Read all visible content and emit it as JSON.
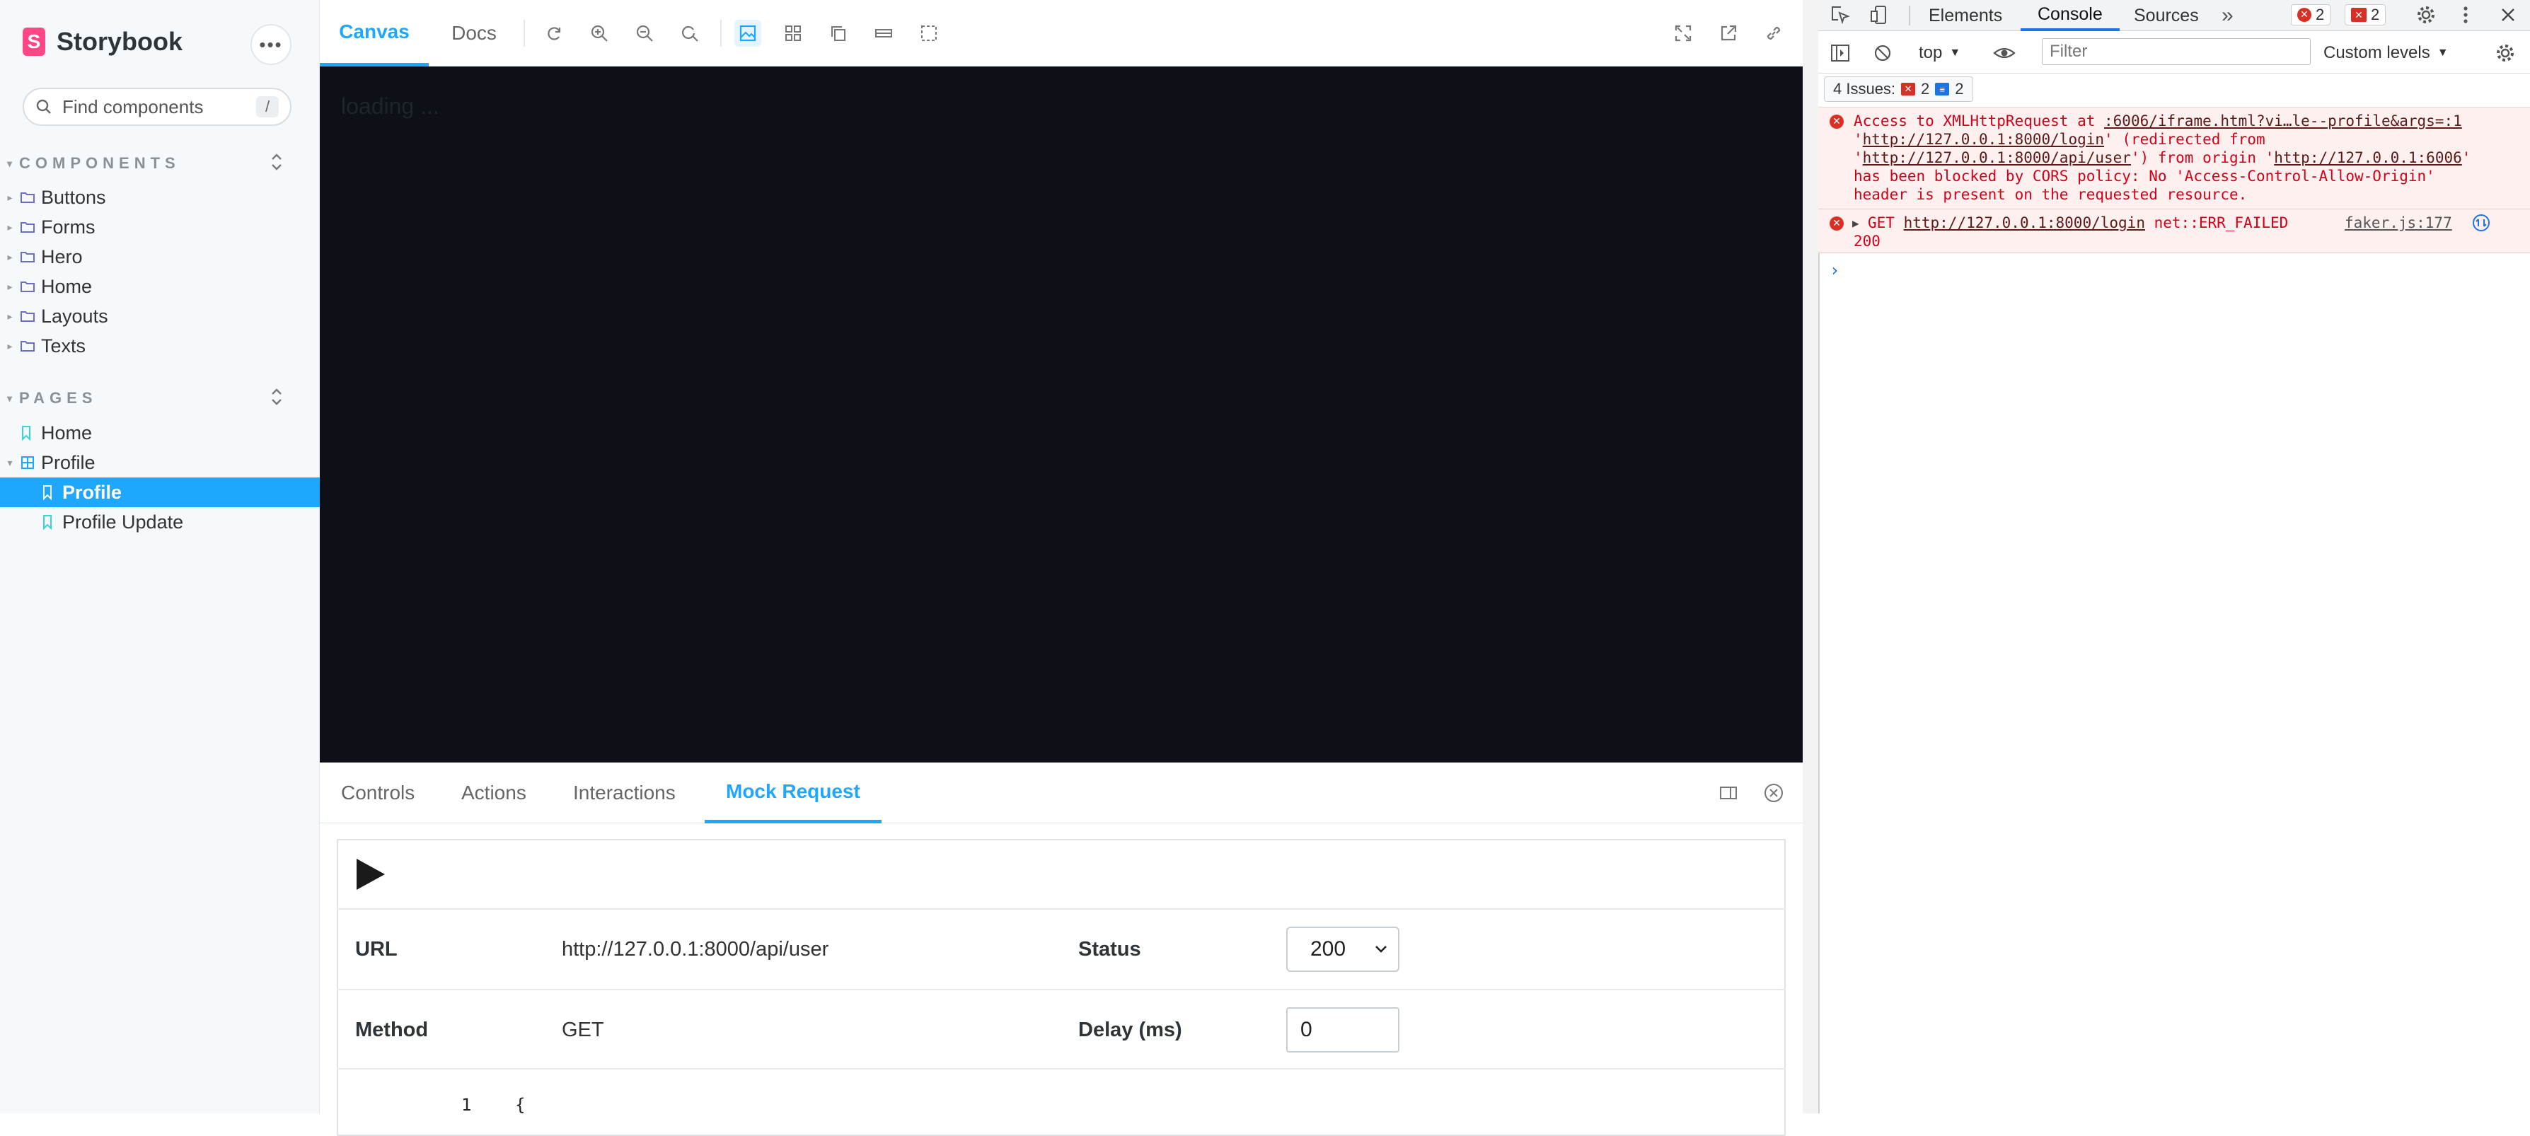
{
  "sidebar": {
    "brand": "Storybook",
    "brand_logo_letter": "S",
    "menu_glyph": "•••",
    "search_placeholder": "Find components",
    "search_shortcut": "/",
    "components_title": "COMPONENTS",
    "components": [
      "Buttons",
      "Forms",
      "Hero",
      "Home",
      "Layouts",
      "Texts"
    ],
    "pages_title": "PAGES",
    "pages": {
      "home": "Home",
      "profile_group": "Profile",
      "profile": "Profile",
      "profile_update": "Profile Update"
    }
  },
  "toolbar": {
    "tabs": [
      "Canvas",
      "Docs"
    ],
    "icons": [
      "reload-icon",
      "zoom-in-icon",
      "zoom-out-icon",
      "zoom-reset-icon",
      "background-icon",
      "grid-icon",
      "viewport-icon",
      "measure-icon",
      "outline-icon",
      "fullscreen-icon",
      "open-new-tab-icon",
      "copy-link-icon"
    ]
  },
  "canvas": {
    "loading_text": "loading ...",
    "background": "#0d1117"
  },
  "addons": {
    "tabs": [
      "Controls",
      "Actions",
      "Interactions",
      "Mock Request"
    ],
    "active_tab": "Mock Request",
    "url_label": "URL",
    "url_value": "http://127.0.0.1:8000/api/user",
    "status_label": "Status",
    "status_value": "200",
    "method_label": "Method",
    "method_value": "GET",
    "delay_label": "Delay (ms)",
    "delay_value": "0",
    "code_line_number": "1",
    "code_line_text": "{"
  },
  "devtools": {
    "tabs": [
      "Elements",
      "Console",
      "Sources"
    ],
    "more_glyph": "»",
    "error_count": "2",
    "warning_count": "2",
    "context": "top",
    "filter_placeholder": "Filter",
    "levels": "Custom levels",
    "issues_label": "4 Issues:",
    "issues_errors": "2",
    "issues_info": "2",
    "messages": {
      "cors": {
        "text_1": "Access to XMLHttpRequest at ",
        "link_1": ":6006/iframe.html?vi…le--profile&args=:1",
        "text_2": "'",
        "link_2": "http://127.0.0.1:8000/login",
        "text_3": "' (redirected from '",
        "link_3": "http://127.0.0.1:8000/api/user",
        "text_4": "') from origin '",
        "link_4": "http://127.0.0.1:6006",
        "text_5": "' has been blocked by CORS policy: No 'Access-Control-Allow-Origin' header is present on the requested resource."
      },
      "get": {
        "method": "GET",
        "url": "http://127.0.0.1:8000/login",
        "error": "net::ERR_FAILED",
        "code": "200",
        "source": "faker.js:177"
      }
    },
    "prompt": "›"
  },
  "colors": {
    "accent": "#1ea7fd",
    "brand": "#ff4785",
    "error": "#d93025"
  }
}
